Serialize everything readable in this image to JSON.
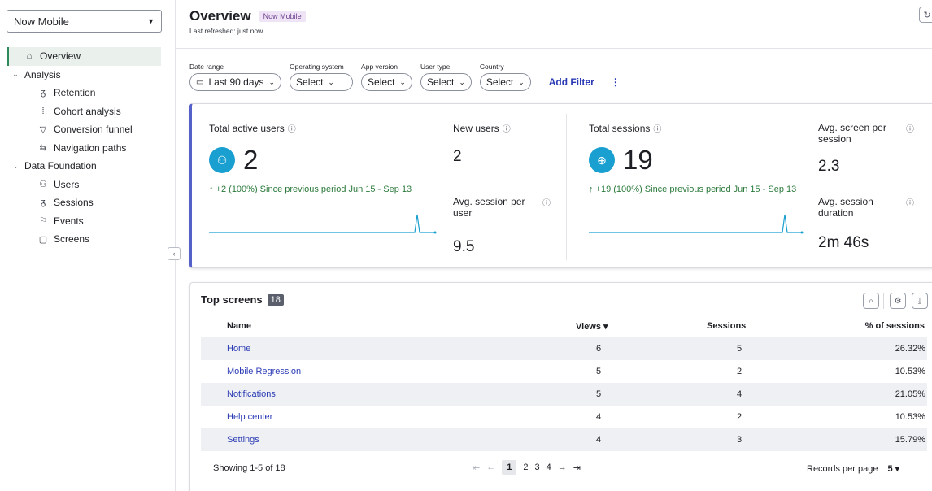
{
  "sidebar": {
    "app_select": "Now Mobile",
    "items": [
      {
        "label": "Overview",
        "icon": "home-icon",
        "level": 0,
        "active": true
      },
      {
        "label": "Analysis",
        "icon": "chevron-down-icon",
        "level": 0,
        "section": true
      },
      {
        "label": "Retention",
        "icon": "retention-icon",
        "level": 1
      },
      {
        "label": "Cohort analysis",
        "icon": "cohort-icon",
        "level": 1
      },
      {
        "label": "Conversion funnel",
        "icon": "funnel-icon",
        "level": 1
      },
      {
        "label": "Navigation paths",
        "icon": "navigation-icon",
        "level": 1
      },
      {
        "label": "Data Foundation",
        "icon": "chevron-down-icon",
        "level": 0,
        "section": true
      },
      {
        "label": "Users",
        "icon": "users-icon",
        "level": 1
      },
      {
        "label": "Sessions",
        "icon": "sessions-icon",
        "level": 1
      },
      {
        "label": "Events",
        "icon": "flag-icon",
        "level": 1
      },
      {
        "label": "Screens",
        "icon": "screen-icon",
        "level": 1
      }
    ]
  },
  "header": {
    "title": "Overview",
    "badge": "Now Mobile",
    "refreshed": "Last refreshed: just now"
  },
  "filters": [
    {
      "label": "Date range",
      "value": "Last 90 days",
      "icon": "calendar-icon"
    },
    {
      "label": "Operating system",
      "value": "Select"
    },
    {
      "label": "App version",
      "value": "Select"
    },
    {
      "label": "User type",
      "value": "Select"
    },
    {
      "label": "Country",
      "value": "Select"
    }
  ],
  "add_filter": "Add Filter",
  "kpis": {
    "active_users": {
      "label": "Total active users",
      "value": "2",
      "delta": "↑ +2 (100%) Since previous period Jun 15 - Sep 13"
    },
    "new_users": {
      "label": "New users",
      "value": "2"
    },
    "avg_session_per_user": {
      "label": "Avg. session per user",
      "value": "9.5"
    },
    "total_sessions": {
      "label": "Total sessions",
      "value": "19",
      "delta": "↑ +19 (100%) Since previous period Jun 15 - Sep 13"
    },
    "avg_screen_per_session": {
      "label": "Avg. screen per session",
      "value": "2.3"
    },
    "avg_session_duration": {
      "label": "Avg. session duration",
      "value": "2m 46s"
    }
  },
  "top_screens": {
    "title": "Top screens",
    "count": "18",
    "columns": [
      "Name",
      "Views ▾",
      "Sessions",
      "% of sessions"
    ],
    "rows": [
      {
        "name": "Home",
        "views": "6",
        "sessions": "5",
        "pct": "26.32%"
      },
      {
        "name": "Mobile Regression",
        "views": "5",
        "sessions": "2",
        "pct": "10.53%"
      },
      {
        "name": "Notifications",
        "views": "5",
        "sessions": "4",
        "pct": "21.05%"
      },
      {
        "name": "Help center",
        "views": "4",
        "sessions": "2",
        "pct": "10.53%"
      },
      {
        "name": "Settings",
        "views": "4",
        "sessions": "3",
        "pct": "15.79%"
      }
    ],
    "showing": "Showing 1-5 of 18",
    "pages": [
      "1",
      "2",
      "3",
      "4"
    ],
    "records_label": "Records per page",
    "records_value": "5 ▾"
  }
}
